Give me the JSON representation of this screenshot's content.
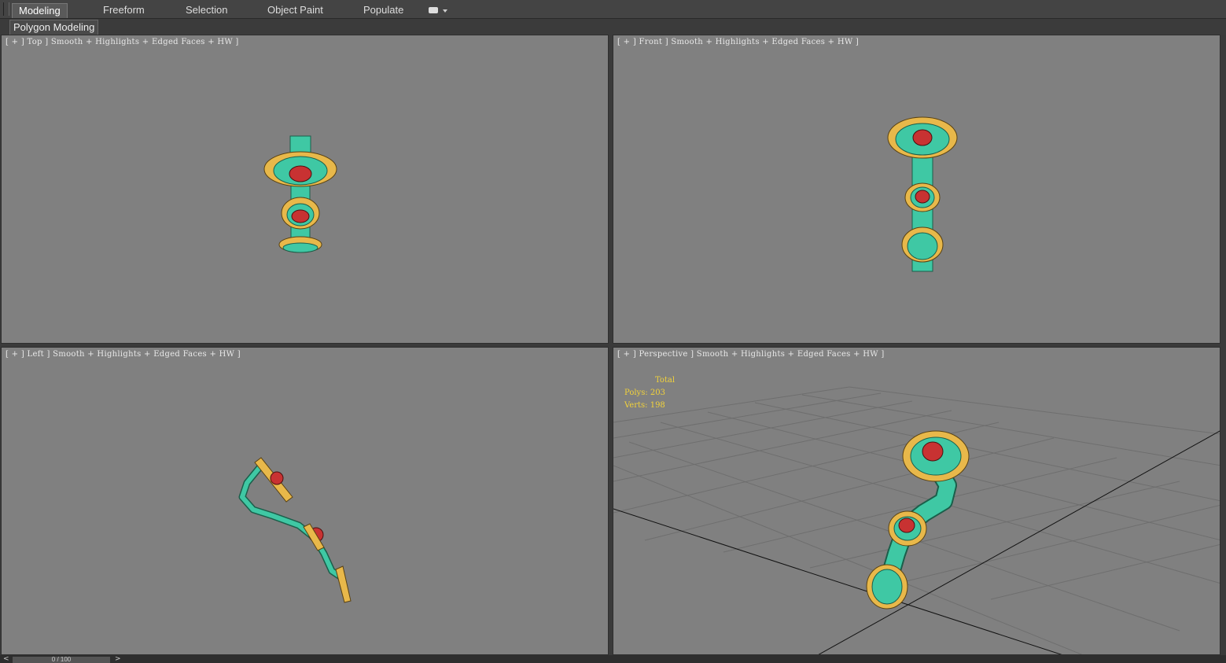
{
  "ribbon": {
    "tabs": [
      {
        "label": "Modeling",
        "active": true
      },
      {
        "label": "Freeform",
        "active": false
      },
      {
        "label": "Selection",
        "active": false
      },
      {
        "label": "Object Paint",
        "active": false
      },
      {
        "label": "Populate",
        "active": false
      }
    ],
    "dropdown_icon": "panel-options-icon",
    "sub_label": "Polygon Modeling"
  },
  "viewports": {
    "top": {
      "label": "[ + ] Top ] Smooth + Highlights + Edged Faces + HW ]"
    },
    "front": {
      "label": "[ + ] Front ] Smooth + Highlights + Edged Faces + HW ]"
    },
    "left": {
      "label": "[ + ] Left ] Smooth + Highlights + Edged Faces + HW ]"
    },
    "perspective": {
      "label": "[ + ] Perspective ] Smooth + Highlights + Edged Faces + HW ]",
      "stats": {
        "title": "Total",
        "polys": "Polys: 203",
        "verts": "Verts: 198"
      }
    }
  },
  "timeline": {
    "frame": "0 / 100",
    "prev": "<",
    "next": ">"
  },
  "colors": {
    "viewport_bg": "#808080",
    "mesh_teal": "#3fc8a4",
    "mesh_gold": "#e8b84a",
    "gem_red": "#c83232",
    "stats_text": "#f2d23a"
  }
}
